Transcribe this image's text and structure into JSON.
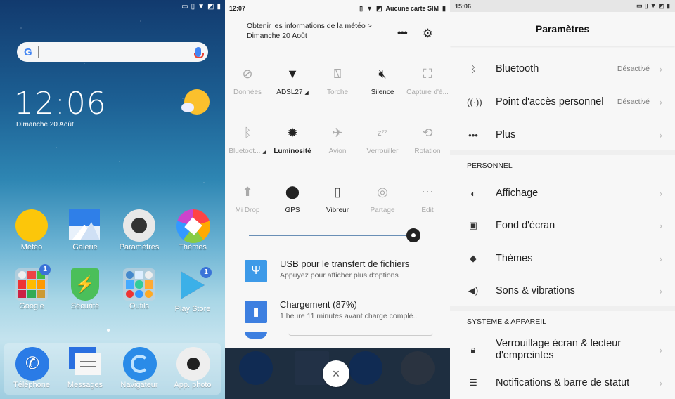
{
  "home": {
    "status_icons": [
      "battery-saver-icon",
      "vibrate-icon",
      "wifi-icon",
      "no-sim-icon",
      "battery-icon"
    ],
    "search": {
      "logo": "G",
      "placeholder": ""
    },
    "clock": "12:06",
    "date": "Dimanche 20 Août",
    "apps": [
      {
        "label": "Météo",
        "icon": "weather-icon"
      },
      {
        "label": "Galerie",
        "icon": "gallery-icon"
      },
      {
        "label": "Paramètres",
        "icon": "settings-icon"
      },
      {
        "label": "Thèmes",
        "icon": "themes-icon"
      },
      {
        "label": "Google",
        "icon": "folder-icon",
        "badge": "1"
      },
      {
        "label": "Sécurité",
        "icon": "security-icon"
      },
      {
        "label": "Outils",
        "icon": "folder-icon"
      },
      {
        "label": "Play Store",
        "icon": "play-store-icon",
        "badge": "1"
      }
    ],
    "dock": [
      {
        "label": "Téléphone",
        "icon": "phone-icon"
      },
      {
        "label": "Messages",
        "icon": "messages-icon"
      },
      {
        "label": "Navigateur",
        "icon": "browser-icon"
      },
      {
        "label": "App. photo",
        "icon": "camera-icon"
      }
    ]
  },
  "shade": {
    "time": "12:07",
    "carrier": "Aucune carte SIM",
    "weather_line": "Obtenir les informations de la météo >",
    "date": "Dimanche 20 Août",
    "tiles": [
      [
        {
          "label": "Données",
          "icon": "mobile-data-icon",
          "on": false
        },
        {
          "label": "ADSL27",
          "icon": "wifi-icon",
          "on": true,
          "expand": true
        },
        {
          "label": "Torche",
          "icon": "flashlight-icon",
          "on": false
        },
        {
          "label": "Silence",
          "icon": "silent-icon",
          "on": true
        },
        {
          "label": "Capture d'é...",
          "icon": "screenshot-icon",
          "on": false
        }
      ],
      [
        {
          "label": "Bluetoot...",
          "icon": "bluetooth-icon",
          "on": false,
          "expand": true
        },
        {
          "label": "Luminosité",
          "icon": "auto-brightness-icon",
          "on": true
        },
        {
          "label": "Avion",
          "icon": "airplane-icon",
          "on": false
        },
        {
          "label": "Verrouiller",
          "icon": "sleep-icon",
          "on": false
        },
        {
          "label": "Rotation",
          "icon": "rotation-icon",
          "on": false
        }
      ],
      [
        {
          "label": "Mi Drop",
          "icon": "mi-drop-icon",
          "on": false
        },
        {
          "label": "GPS",
          "icon": "location-icon",
          "on": true
        },
        {
          "label": "Vibreur",
          "icon": "vibrate-icon",
          "on": true
        },
        {
          "label": "Partage",
          "icon": "hotspot-icon",
          "on": false
        },
        {
          "label": "Edit",
          "icon": "edit-icon",
          "on": false
        }
      ]
    ],
    "brightness_percent": 96,
    "notifications": [
      {
        "title": "USB pour le transfert de fichiers",
        "subtitle": "Appuyez pour afficher plus d'options",
        "icon": "usb-icon",
        "color": "#3d9ae8"
      },
      {
        "title": "Chargement (87%)",
        "subtitle": "1 heure 11 minutes  avant charge complè..",
        "icon": "battery-charging-icon",
        "color": "#3d7fe0"
      }
    ],
    "close_label": "×"
  },
  "settings": {
    "time": "15:06",
    "title": "Paramètres",
    "rows_top": [
      {
        "label": "Bluetooth",
        "value": "Désactivé",
        "icon": "bluetooth-icon"
      },
      {
        "label": "Point d'accès personnel",
        "value": "Désactivé",
        "icon": "hotspot-icon"
      },
      {
        "label": "Plus",
        "value": "",
        "icon": "more-icon"
      }
    ],
    "section_personal": "PERSONNEL",
    "rows_personal": [
      {
        "label": "Affichage",
        "icon": "display-icon"
      },
      {
        "label": "Fond d'écran",
        "icon": "wallpaper-icon"
      },
      {
        "label": "Thèmes",
        "icon": "themes-icon"
      },
      {
        "label": "Sons & vibrations",
        "icon": "sound-icon"
      }
    ],
    "section_system": "SYSTÈME & APPAREIL",
    "rows_system": [
      {
        "label": "Verrouillage écran & lecteur d'empreintes",
        "icon": "lock-icon"
      },
      {
        "label": "Notifications & barre de statut",
        "icon": "notifications-icon"
      }
    ]
  },
  "colors": {
    "accent": "#3a73d8",
    "shade_bg": "#f7f7f7",
    "settings_bg": "#f7f7f7"
  }
}
